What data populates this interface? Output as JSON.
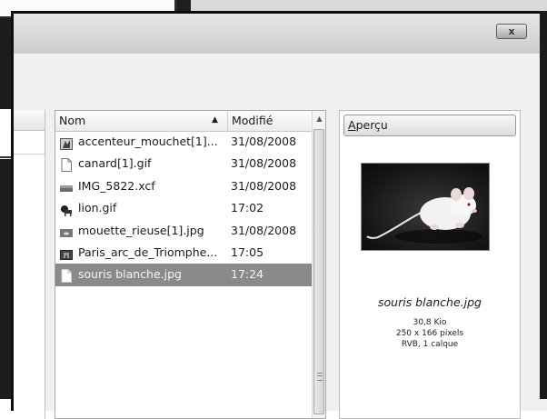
{
  "dialog": {
    "close_label": "x"
  },
  "file_list": {
    "columns": {
      "name": "Nom",
      "modified": "Modifié"
    },
    "sort_indicator": "▲",
    "rows": [
      {
        "name": "accenteur_mouchet[1]...",
        "modified": "31/08/2008",
        "icon": "image-icon"
      },
      {
        "name": "canard[1].gif",
        "modified": "31/08/2008",
        "icon": "blank-file-icon"
      },
      {
        "name": "IMG_5822.xcf",
        "modified": "31/08/2008",
        "icon": "image-icon"
      },
      {
        "name": "lion.gif",
        "modified": "17:02",
        "icon": "lion-icon"
      },
      {
        "name": "mouette_rieuse[1].jpg",
        "modified": "31/08/2008",
        "icon": "image-icon"
      },
      {
        "name": "Paris_arc_de_Triomphe...",
        "modified": "17:05",
        "icon": "image-icon"
      },
      {
        "name": "souris blanche.jpg",
        "modified": "17:24",
        "icon": "blank-file-icon",
        "selected": true
      }
    ]
  },
  "preview": {
    "button_label_u": "A",
    "button_label_rest": "perçu",
    "file_name": "souris blanche.jpg",
    "info_lines": [
      "30,8 Kio",
      "250 x 166 pixels",
      "RVB, 1 calque"
    ]
  }
}
